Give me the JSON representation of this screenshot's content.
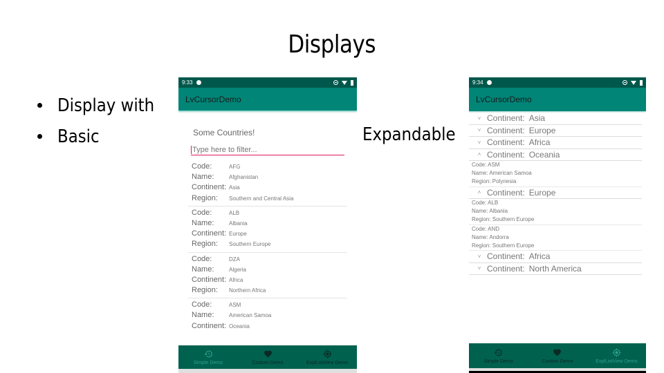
{
  "slide": {
    "title": "Displays",
    "bullets": [
      "Display with",
      "Basic"
    ],
    "expandable_label": "Expandable"
  },
  "colors": {
    "status_bar": "#00574b",
    "app_bar": "#008577",
    "bottom_nav": "#00614f",
    "accent": "#d81b60",
    "nav_active": "#2da18d"
  },
  "phone1": {
    "status": {
      "time": "9:33"
    },
    "app_title": "LvCursorDemo",
    "heading": "Some Countries!",
    "filter_placeholder": "Type here to filter...",
    "field_labels": {
      "code": "Code:",
      "name": "Name:",
      "continent": "Continent:",
      "region": "Region:"
    },
    "records": [
      {
        "code": "AFG",
        "name": "Afghanistan",
        "continent": "Asia",
        "region": "Southern and Central Asia"
      },
      {
        "code": "ALB",
        "name": "Albania",
        "continent": "Europe",
        "region": "Southern Europe"
      },
      {
        "code": "DZA",
        "name": "Algeria",
        "continent": "Africa",
        "region": "Northern Africa"
      },
      {
        "code": "ASM",
        "name": "American Samoa",
        "continent": "Oceania"
      }
    ],
    "nav": [
      {
        "label": "Simple Demo",
        "icon": "history-icon",
        "active": true
      },
      {
        "label": "Custom Demo",
        "icon": "heart-icon",
        "active": false
      },
      {
        "label": "ExplListView Demo",
        "icon": "target-icon",
        "active": false
      }
    ]
  },
  "phone2": {
    "status": {
      "time": "9:34"
    },
    "app_title": "LvCursorDemo",
    "group_key": "Continent:",
    "items": [
      {
        "type": "group",
        "value": "Asia",
        "expanded": false
      },
      {
        "type": "group",
        "value": "Europe",
        "expanded": false
      },
      {
        "type": "group",
        "value": "Africa",
        "expanded": false
      },
      {
        "type": "group",
        "value": "Oceania",
        "expanded": true
      },
      {
        "type": "child",
        "lines": [
          "Code: ASM",
          "Name: American Samoa",
          "Region: Polynesia"
        ]
      },
      {
        "type": "group",
        "value": "Europe",
        "expanded": true
      },
      {
        "type": "child",
        "lines": [
          "Code: ALB",
          "Name: Albania",
          "Region: Southern Europe"
        ]
      },
      {
        "type": "child",
        "lines": [
          "Code: AND",
          "Name: Andorra",
          "Region: Southern Europe"
        ]
      },
      {
        "type": "group",
        "value": "Africa",
        "expanded": false
      },
      {
        "type": "group",
        "value": "North America",
        "expanded": false
      }
    ],
    "nav": [
      {
        "label": "Simple Demo",
        "icon": "history-icon",
        "active": false
      },
      {
        "label": "Custom Demo",
        "icon": "heart-icon",
        "active": false
      },
      {
        "label": "ExplListView Demo",
        "icon": "target-icon",
        "active": true
      }
    ]
  }
}
